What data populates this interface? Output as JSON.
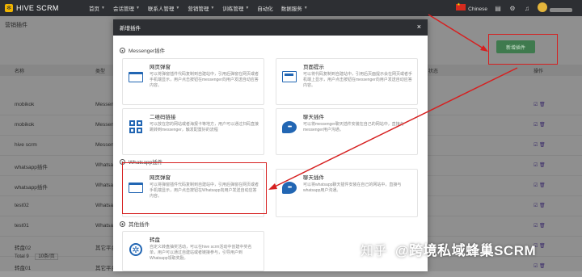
{
  "app": {
    "logo_mark": "✻",
    "logo_text": "HIVE SCRM"
  },
  "nav": [
    {
      "label": "首页"
    },
    {
      "label": "会话管理"
    },
    {
      "label": "联系人管理"
    },
    {
      "label": "营销管理"
    },
    {
      "label": "训练管理"
    },
    {
      "label": "自动化"
    },
    {
      "label": "数据服务"
    }
  ],
  "header": {
    "language": "Chinese",
    "icons": [
      "document-icon",
      "gear-icon",
      "bell-icon"
    ]
  },
  "page": {
    "title": "营销插件",
    "add_button": "新增插件",
    "columns": [
      "名称",
      "类型",
      "状态",
      "操作"
    ],
    "rows": [
      {
        "name": "mobikok",
        "type": "Messenger"
      },
      {
        "name": "mobikok",
        "type": "Messenger"
      },
      {
        "name": "hive scrm",
        "type": "Messenger"
      },
      {
        "name": "whatsapp插件",
        "type": "Whatsapp"
      },
      {
        "name": "whatsapp插件",
        "type": "Whatsapp"
      },
      {
        "name": "test02",
        "type": "Whatsapp"
      },
      {
        "name": "test01",
        "type": "Whatsapp"
      },
      {
        "name": "转盘02",
        "type": "其它平台"
      },
      {
        "name": "转盘01",
        "type": "其它平台"
      }
    ],
    "pager_total": "Total 9",
    "pager_size": "10条/页"
  },
  "modal": {
    "title": "新增插件",
    "sections": {
      "messenger": "Messenger插件",
      "whatsapp": "Whatsapp插件",
      "other": "其他插件"
    },
    "cards": {
      "m_web": {
        "title": "网页弹窗",
        "desc": "可以将弹窗插件代码复制到自建站中，引用后弹窗在网页或者手机端显示，用户点击按钮在messenger向用户发送自动应答内容。"
      },
      "m_page": {
        "title": "页面提示",
        "desc": "可以将代码复制到自建站中，引用后页面提示会在网页或者手机端上显示，用户点击按钮在messenger向用户发送自动应答内容。"
      },
      "m_qr": {
        "title": "二维码链接",
        "desc": "可以放在您的网站或者海报卡等地方，用户可以通过扫码直接跳转到messenger，触发配置好的流程"
      },
      "m_chat": {
        "title": "聊天插件",
        "desc": "可以将messenger聊天插件安装在自己的网站中，直接与messenger用户沟通。"
      },
      "w_web": {
        "title": "网页弹窗",
        "desc": "可以将弹窗插件代码复制到自建站中，引用后弹窗在网页或者手机端显示，用户点击按钮在Whatsapp向用户发送自动应答内容。"
      },
      "w_chat": {
        "title": "聊天插件",
        "desc": "可以将whatsapp聊天插件安装在自己的网站中，直接与whatsapp用户沟通。"
      },
      "o_wheel": {
        "title": "转盘",
        "desc": "自定义转盘抽奖活动，可以在hive scrm活动中创建中奖名单，用户可以通过自建站或者链接参与，引导用户到Whatsapp领取奖励。"
      }
    }
  },
  "watermark": {
    "zhihu": "知乎",
    "brand": "@跨境私域蜂巢SCRM"
  },
  "colors": {
    "accent": "#2266b3",
    "highlight": "#d62020",
    "topbar": "#2d2f33",
    "add_button": "#3f7a4e"
  }
}
